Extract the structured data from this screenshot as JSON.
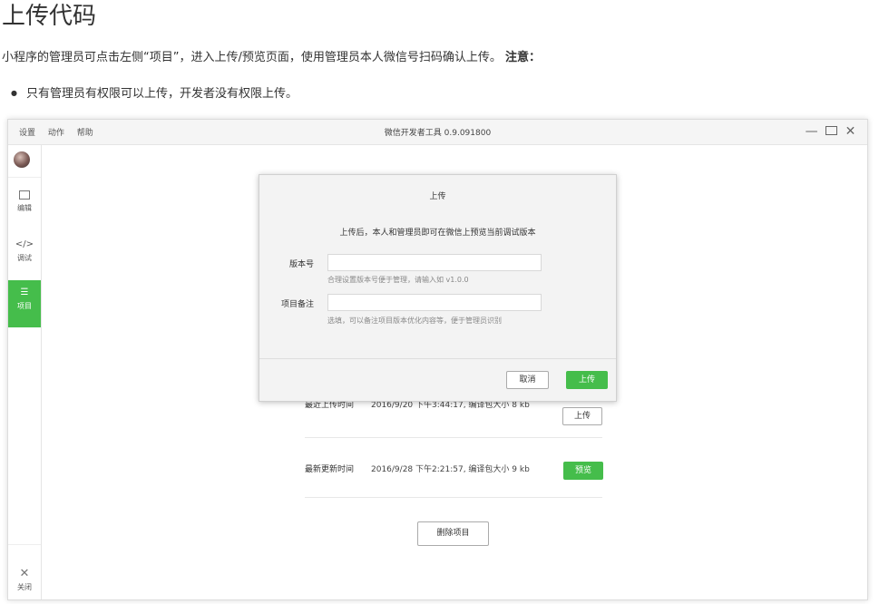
{
  "doc": {
    "title": "上传代码",
    "paragraph": "小程序的管理员可点击左侧“项目”，进入上传/预览页面，使用管理员本人微信号扫码确认上传。",
    "note": "注意：",
    "bullets": [
      "只有管理员有权限可以上传，开发者没有权限上传。"
    ]
  },
  "window": {
    "menu": [
      "设置",
      "动作",
      "帮助"
    ],
    "title": "微信开发者工具 0.9.091800",
    "controls": {
      "minimize": "—",
      "close": "✕"
    }
  },
  "sidebar": {
    "items": [
      {
        "label": "编辑"
      },
      {
        "label": "调试",
        "icon_text": "</>"
      },
      {
        "label": "项目",
        "icon_text": "☰"
      }
    ],
    "close_label": "关闭",
    "close_icon": "✕"
  },
  "project": {
    "rows": [
      {
        "label": "最近上传时间",
        "value": "2016/9/20 下午3:44:17, 编译包大小 8 kb",
        "button": "上传"
      },
      {
        "label": "最新更新时间",
        "value": "2016/9/28 下午2:21:57, 编译包大小 9 kb",
        "button": "预览"
      }
    ],
    "delete_button": "删除项目"
  },
  "dialog": {
    "title": "上传",
    "description": "上传后，本人和管理员即可在微信上预览当前调试版本",
    "version_label": "版本号",
    "version_value": "",
    "version_hint": "合理设置版本号便于管理，请输入如 v1.0.0",
    "note_label": "项目备注",
    "note_value": "",
    "note_hint": "选填，可以备注项目版本优化内容等，便于管理员识别",
    "cancel": "取消",
    "upload": "上传"
  }
}
